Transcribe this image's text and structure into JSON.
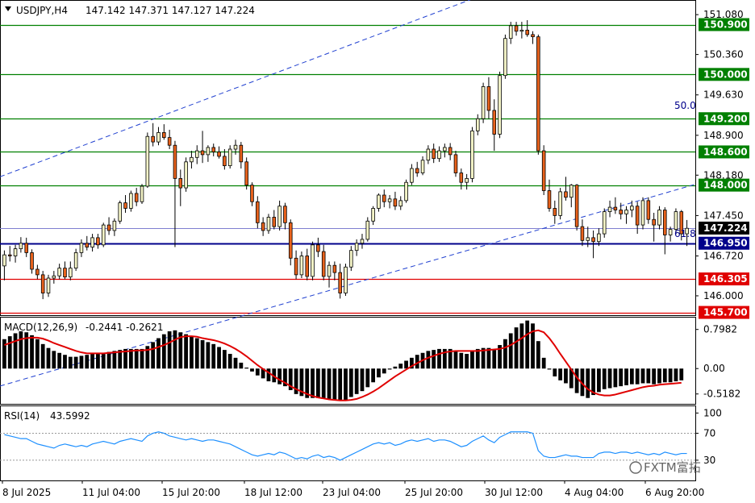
{
  "header": {
    "symbol": "USDJPY,H4",
    "ohlc": "147.142 147.371 147.127 147.224"
  },
  "colors": {
    "bull": "#f5f5c8",
    "bear": "#e8621c",
    "candle_outline": "#000000",
    "resistance": "#008000",
    "support": "#e00000",
    "pivot": "#00008b",
    "channel": "#2040d0",
    "macd_signal": "#e00000",
    "rsi_line": "#1e90ff",
    "current_price_bg": "#000000"
  },
  "price_axis": {
    "ticks": [
      "151.080",
      "150.360",
      "149.630",
      "148.900",
      "148.180",
      "147.450",
      "146.720",
      "146.000"
    ]
  },
  "levels": [
    {
      "label": "150.900",
      "kind": "resistance"
    },
    {
      "label": "150.000",
      "kind": "resistance"
    },
    {
      "label": "149.200",
      "kind": "resistance"
    },
    {
      "label": "148.600",
      "kind": "resistance"
    },
    {
      "label": "148.000",
      "kind": "resistance"
    },
    {
      "label": "147.224",
      "kind": "current"
    },
    {
      "label": "146.950",
      "kind": "pivot"
    },
    {
      "label": "146.305",
      "kind": "support"
    },
    {
      "label": "145.700",
      "kind": "support"
    }
  ],
  "fib_labels": [
    "50.0",
    "61.8"
  ],
  "macd": {
    "label": "MACD(12,26,9)",
    "values_text": "-0.2441  -0.2621",
    "ticks": [
      "0.7982",
      "0.00",
      "-0.5182"
    ]
  },
  "rsi": {
    "label": "RSI(14)",
    "value_text": "43.5992",
    "ticks": [
      "100",
      "70",
      "30"
    ]
  },
  "time_axis": {
    "labels": [
      "8 Jul 2025",
      "11 Jul 04:00",
      "15 Jul 20:00",
      "18 Jul 12:00",
      "23 Jul 04:00",
      "25 Jul 20:00",
      "30 Jul 12:00",
      "4 Aug 04:00",
      "6 Aug 20:00"
    ]
  },
  "watermark": "FXTM富拓",
  "chart_data": [
    {
      "type": "candlestick",
      "title": "USDJPY,H4",
      "y_range": [
        145.65,
        151.33
      ],
      "candles": [
        [
          146.54,
          146.82,
          146.28,
          146.74
        ],
        [
          146.74,
          146.9,
          146.62,
          146.72
        ],
        [
          146.72,
          146.92,
          146.6,
          146.85
        ],
        [
          146.85,
          147.06,
          146.78,
          146.95
        ],
        [
          146.95,
          147.05,
          146.7,
          146.78
        ],
        [
          146.78,
          146.84,
          146.4,
          146.48
        ],
        [
          146.48,
          146.56,
          146.3,
          146.38
        ],
        [
          146.38,
          146.45,
          145.94,
          146.05
        ],
        [
          146.05,
          146.38,
          145.98,
          146.32
        ],
        [
          146.32,
          146.45,
          146.22,
          146.36
        ],
        [
          146.36,
          146.58,
          146.3,
          146.5
        ],
        [
          146.5,
          146.62,
          146.3,
          146.34
        ],
        [
          146.34,
          146.62,
          146.28,
          146.5
        ],
        [
          146.5,
          146.85,
          146.45,
          146.78
        ],
        [
          146.78,
          147.02,
          146.7,
          146.95
        ],
        [
          146.95,
          147.08,
          146.82,
          146.88
        ],
        [
          146.88,
          147.12,
          146.8,
          147.05
        ],
        [
          147.05,
          147.12,
          146.85,
          146.92
        ],
        [
          146.92,
          147.32,
          146.88,
          147.28
        ],
        [
          147.28,
          147.42,
          147.1,
          147.18
        ],
        [
          147.18,
          147.4,
          147.08,
          147.35
        ],
        [
          147.35,
          147.72,
          147.3,
          147.68
        ],
        [
          147.68,
          147.82,
          147.5,
          147.58
        ],
        [
          147.58,
          147.9,
          147.52,
          147.85
        ],
        [
          147.85,
          147.95,
          147.62,
          147.7
        ],
        [
          147.7,
          148.02,
          147.66,
          147.98
        ],
        [
          147.98,
          148.95,
          147.95,
          148.88
        ],
        [
          148.88,
          149.12,
          148.7,
          148.78
        ],
        [
          148.78,
          149.05,
          148.72,
          148.95
        ],
        [
          148.95,
          149.1,
          148.82,
          148.86
        ],
        [
          148.86,
          149.0,
          148.65,
          148.72
        ],
        [
          148.72,
          148.8,
          146.88,
          148.12
        ],
        [
          148.12,
          148.28,
          147.62,
          147.95
        ],
        [
          147.95,
          148.5,
          147.88,
          148.42
        ],
        [
          148.42,
          148.62,
          148.3,
          148.5
        ],
        [
          148.5,
          148.72,
          148.38,
          148.62
        ],
        [
          148.62,
          148.98,
          148.4,
          148.55
        ],
        [
          148.55,
          148.72,
          148.42,
          148.68
        ],
        [
          148.68,
          148.75,
          148.52,
          148.6
        ],
        [
          148.6,
          148.7,
          148.48,
          148.52
        ],
        [
          148.52,
          148.65,
          148.28,
          148.35
        ],
        [
          148.35,
          148.72,
          148.3,
          148.65
        ],
        [
          148.65,
          148.82,
          148.55,
          148.72
        ],
        [
          148.72,
          148.78,
          148.3,
          148.42
        ],
        [
          148.42,
          148.5,
          147.92,
          148.0
        ],
        [
          148.0,
          148.05,
          147.62,
          147.7
        ],
        [
          147.7,
          147.8,
          147.22,
          147.32
        ],
        [
          147.32,
          147.42,
          147.08,
          147.18
        ],
        [
          147.18,
          147.48,
          147.12,
          147.42
        ],
        [
          147.42,
          147.55,
          147.2,
          147.25
        ],
        [
          147.25,
          147.72,
          147.18,
          147.62
        ],
        [
          147.62,
          147.68,
          147.2,
          147.32
        ],
        [
          147.32,
          147.38,
          146.55,
          146.68
        ],
        [
          146.68,
          146.82,
          146.3,
          146.38
        ],
        [
          146.38,
          146.8,
          146.32,
          146.72
        ],
        [
          146.72,
          146.85,
          146.28,
          146.35
        ],
        [
          146.35,
          146.98,
          146.28,
          146.92
        ],
        [
          146.92,
          147.05,
          146.7,
          146.8
        ],
        [
          146.8,
          146.92,
          146.28,
          146.35
        ],
        [
          146.35,
          146.62,
          146.15,
          146.55
        ],
        [
          146.55,
          146.62,
          146.28,
          146.42
        ],
        [
          146.42,
          146.58,
          145.95,
          146.05
        ],
        [
          146.05,
          146.58,
          146.0,
          146.52
        ],
        [
          146.52,
          146.9,
          146.45,
          146.82
        ],
        [
          146.82,
          147.02,
          146.72,
          146.95
        ],
        [
          146.95,
          147.12,
          146.85,
          147.02
        ],
        [
          147.02,
          147.42,
          146.98,
          147.35
        ],
        [
          147.35,
          147.62,
          147.28,
          147.58
        ],
        [
          147.58,
          147.85,
          147.52,
          147.82
        ],
        [
          147.82,
          147.92,
          147.6,
          147.7
        ],
        [
          147.7,
          147.82,
          147.58,
          147.75
        ],
        [
          147.75,
          147.88,
          147.55,
          147.62
        ],
        [
          147.62,
          147.8,
          147.55,
          147.72
        ],
        [
          147.72,
          148.1,
          147.68,
          148.05
        ],
        [
          148.05,
          148.38,
          148.0,
          148.3
        ],
        [
          148.3,
          148.42,
          148.15,
          148.22
        ],
        [
          148.22,
          148.52,
          148.18,
          148.45
        ],
        [
          148.45,
          148.72,
          148.38,
          148.65
        ],
        [
          148.65,
          148.75,
          148.4,
          148.48
        ],
        [
          148.48,
          148.7,
          148.42,
          148.62
        ],
        [
          148.62,
          148.75,
          148.5,
          148.68
        ],
        [
          148.68,
          148.76,
          148.45,
          148.55
        ],
        [
          148.55,
          148.62,
          148.15,
          148.22
        ],
        [
          148.22,
          148.3,
          147.92,
          148.05
        ],
        [
          148.05,
          148.2,
          147.92,
          148.12
        ],
        [
          148.12,
          149.05,
          148.05,
          148.98
        ],
        [
          148.98,
          149.28,
          148.9,
          149.2
        ],
        [
          149.2,
          149.85,
          149.12,
          149.78
        ],
        [
          149.78,
          149.95,
          149.2,
          149.35
        ],
        [
          149.35,
          149.55,
          148.62,
          148.92
        ],
        [
          148.92,
          150.05,
          148.85,
          149.98
        ],
        [
          149.98,
          150.72,
          149.92,
          150.65
        ],
        [
          150.65,
          150.95,
          150.55,
          150.88
        ],
        [
          150.88,
          150.95,
          150.7,
          150.78
        ],
        [
          150.78,
          150.95,
          150.65,
          150.8
        ],
        [
          150.8,
          150.98,
          150.68,
          150.72
        ],
        [
          150.72,
          150.78,
          150.55,
          150.68
        ],
        [
          150.68,
          150.72,
          148.55,
          148.62
        ],
        [
          148.62,
          148.72,
          147.82,
          147.9
        ],
        [
          147.9,
          148.1,
          147.52,
          147.58
        ],
        [
          147.58,
          147.72,
          147.3,
          147.45
        ],
        [
          147.45,
          147.95,
          147.38,
          147.88
        ],
        [
          147.88,
          148.15,
          147.72,
          147.78
        ],
        [
          147.78,
          148.02,
          147.6,
          148.0
        ],
        [
          148.0,
          148.02,
          147.18,
          147.25
        ],
        [
          147.25,
          147.38,
          146.9,
          147.0
        ],
        [
          147.0,
          147.25,
          146.88,
          147.05
        ],
        [
          147.05,
          147.18,
          146.68,
          146.98
        ],
        [
          146.98,
          147.22,
          146.9,
          147.12
        ],
        [
          147.12,
          147.58,
          147.05,
          147.52
        ],
        [
          147.52,
          147.72,
          147.42,
          147.6
        ],
        [
          147.6,
          147.78,
          147.48,
          147.55
        ],
        [
          147.55,
          147.68,
          147.38,
          147.48
        ],
        [
          147.48,
          147.62,
          147.3,
          147.55
        ],
        [
          147.55,
          147.72,
          147.42,
          147.62
        ],
        [
          147.62,
          147.7,
          147.12,
          147.28
        ],
        [
          147.28,
          147.78,
          147.2,
          147.72
        ],
        [
          147.72,
          147.78,
          147.3,
          147.38
        ],
        [
          147.38,
          147.5,
          146.98,
          147.28
        ],
        [
          147.28,
          147.62,
          147.2,
          147.55
        ],
        [
          147.55,
          147.6,
          146.75,
          147.1
        ],
        [
          147.1,
          147.25,
          146.98,
          147.2
        ],
        [
          147.2,
          147.58,
          147.12,
          147.52
        ],
        [
          147.52,
          147.55,
          147.0,
          147.12
        ],
        [
          147.12,
          147.37,
          146.9,
          147.22
        ]
      ]
    },
    {
      "type": "histogram_line",
      "title": "MACD(12,26,9)",
      "y_range": [
        -0.72,
        1.04
      ],
      "histogram": [
        0.6,
        0.66,
        0.72,
        0.76,
        0.74,
        0.68,
        0.6,
        0.5,
        0.42,
        0.36,
        0.32,
        0.28,
        0.24,
        0.24,
        0.26,
        0.28,
        0.3,
        0.3,
        0.32,
        0.34,
        0.36,
        0.38,
        0.4,
        0.4,
        0.4,
        0.4,
        0.46,
        0.54,
        0.62,
        0.7,
        0.76,
        0.78,
        0.74,
        0.7,
        0.66,
        0.62,
        0.58,
        0.54,
        0.5,
        0.44,
        0.38,
        0.3,
        0.22,
        0.12,
        0.02,
        -0.06,
        -0.14,
        -0.2,
        -0.26,
        -0.28,
        -0.32,
        -0.36,
        -0.44,
        -0.52,
        -0.56,
        -0.6,
        -0.6,
        -0.6,
        -0.62,
        -0.62,
        -0.64,
        -0.66,
        -0.64,
        -0.58,
        -0.52,
        -0.46,
        -0.38,
        -0.28,
        -0.18,
        -0.1,
        -0.02,
        0.04,
        0.1,
        0.16,
        0.22,
        0.28,
        0.32,
        0.36,
        0.38,
        0.4,
        0.4,
        0.4,
        0.36,
        0.32,
        0.3,
        0.36,
        0.4,
        0.42,
        0.42,
        0.38,
        0.48,
        0.6,
        0.72,
        0.84,
        0.92,
        0.98,
        0.92,
        0.56,
        0.22,
        -0.02,
        -0.16,
        -0.24,
        -0.3,
        -0.4,
        -0.5,
        -0.56,
        -0.6,
        -0.54,
        -0.48,
        -0.42,
        -0.4,
        -0.38,
        -0.36,
        -0.34,
        -0.32,
        -0.32,
        -0.3,
        -0.3,
        -0.32,
        -0.3,
        -0.28,
        -0.28,
        -0.26,
        -0.24
      ],
      "signal": [
        0.48,
        0.52,
        0.56,
        0.6,
        0.62,
        0.63,
        0.63,
        0.61,
        0.57,
        0.52,
        0.48,
        0.44,
        0.4,
        0.36,
        0.33,
        0.31,
        0.31,
        0.31,
        0.31,
        0.32,
        0.33,
        0.34,
        0.35,
        0.36,
        0.37,
        0.37,
        0.38,
        0.4,
        0.44,
        0.48,
        0.53,
        0.59,
        0.64,
        0.66,
        0.66,
        0.65,
        0.62,
        0.6,
        0.58,
        0.55,
        0.51,
        0.46,
        0.4,
        0.33,
        0.25,
        0.16,
        0.07,
        -0.01,
        -0.08,
        -0.16,
        -0.23,
        -0.29,
        -0.36,
        -0.42,
        -0.47,
        -0.52,
        -0.56,
        -0.59,
        -0.61,
        -0.63,
        -0.64,
        -0.65,
        -0.65,
        -0.64,
        -0.62,
        -0.58,
        -0.53,
        -0.47,
        -0.4,
        -0.32,
        -0.24,
        -0.16,
        -0.09,
        -0.02,
        0.05,
        0.11,
        0.17,
        0.22,
        0.26,
        0.3,
        0.33,
        0.35,
        0.36,
        0.36,
        0.36,
        0.36,
        0.36,
        0.37,
        0.38,
        0.39,
        0.4,
        0.43,
        0.48,
        0.55,
        0.62,
        0.7,
        0.76,
        0.78,
        0.74,
        0.62,
        0.47,
        0.3,
        0.14,
        -0.02,
        -0.18,
        -0.31,
        -0.42,
        -0.49,
        -0.53,
        -0.55,
        -0.55,
        -0.53,
        -0.5,
        -0.47,
        -0.44,
        -0.41,
        -0.38,
        -0.36,
        -0.35,
        -0.33,
        -0.32,
        -0.31,
        -0.3,
        -0.29
      ]
    },
    {
      "type": "line",
      "title": "RSI(14)",
      "y_range": [
        0,
        110
      ],
      "levels": [
        70,
        30
      ],
      "values": [
        68,
        66,
        64,
        62,
        62,
        58,
        54,
        52,
        50,
        48,
        52,
        54,
        52,
        50,
        52,
        50,
        54,
        56,
        58,
        56,
        54,
        58,
        60,
        62,
        60,
        58,
        66,
        70,
        72,
        70,
        66,
        64,
        62,
        60,
        62,
        60,
        58,
        60,
        60,
        58,
        56,
        54,
        50,
        46,
        42,
        38,
        36,
        38,
        40,
        38,
        42,
        40,
        36,
        32,
        34,
        32,
        36,
        38,
        34,
        36,
        34,
        30,
        34,
        38,
        42,
        46,
        50,
        54,
        56,
        54,
        56,
        52,
        54,
        58,
        60,
        58,
        60,
        62,
        58,
        60,
        60,
        58,
        54,
        50,
        52,
        58,
        62,
        66,
        60,
        56,
        64,
        68,
        72,
        72,
        72,
        72,
        70,
        44,
        36,
        34,
        34,
        36,
        38,
        36,
        36,
        34,
        34,
        34,
        40,
        42,
        42,
        40,
        42,
        42,
        40,
        42,
        40,
        38,
        40,
        38,
        42,
        40,
        38,
        40,
        40
      ]
    }
  ]
}
